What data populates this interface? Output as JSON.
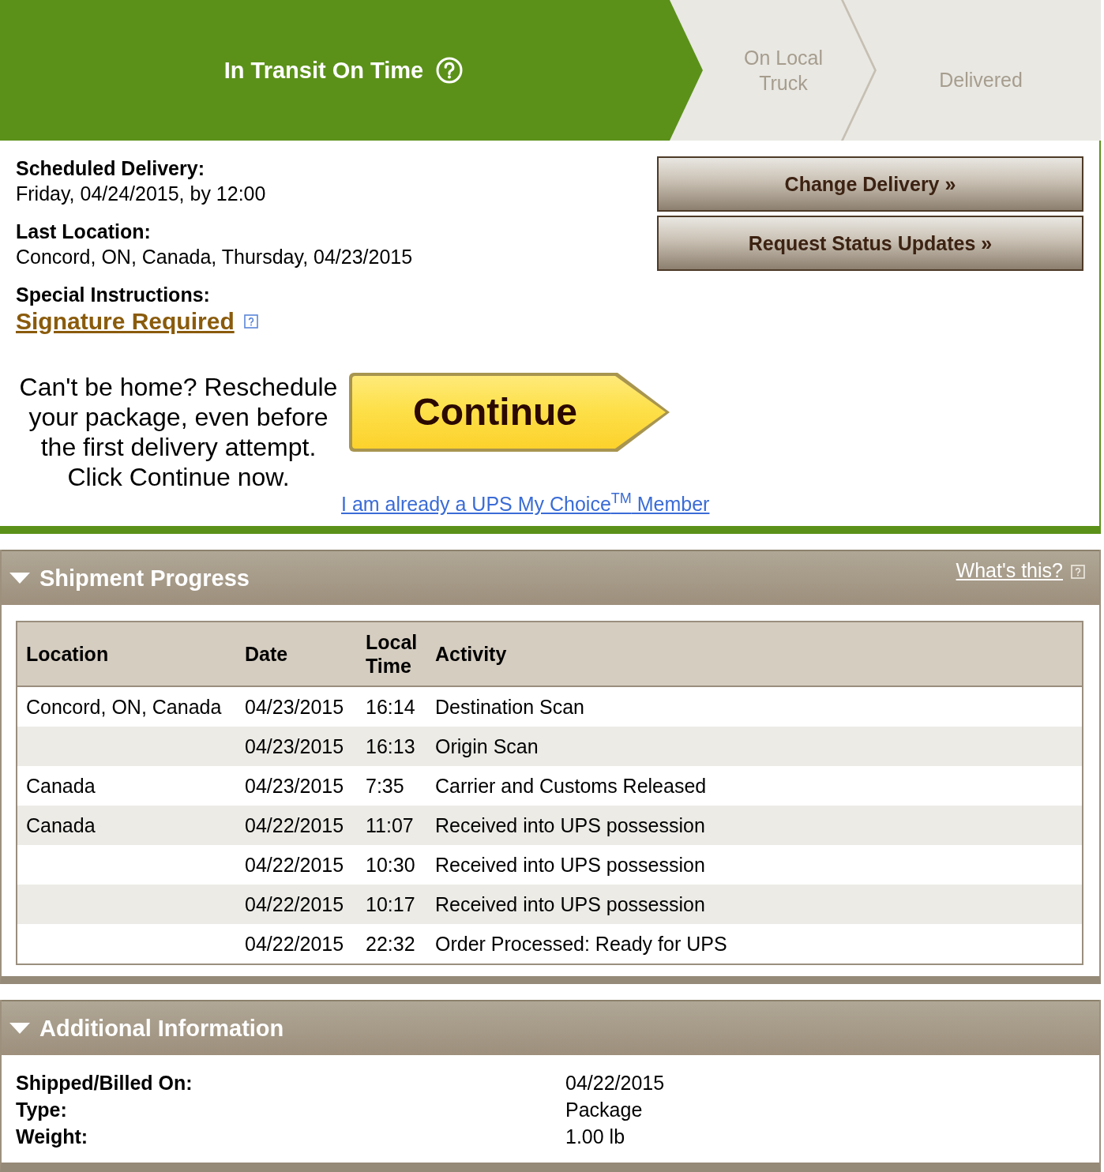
{
  "progress": {
    "steps": [
      {
        "label": "In Transit On Time",
        "active": true,
        "help": true
      },
      {
        "label": "On Local Truck",
        "active": false
      },
      {
        "label": "Delivered",
        "active": false
      }
    ]
  },
  "summary": {
    "fields": [
      {
        "label": "Scheduled Delivery:",
        "value": "Friday, 04/24/2015, by 12:00",
        "kind": "text"
      },
      {
        "label": "Last Location:",
        "value": "Concord, ON, Canada, Thursday, 04/23/2015",
        "kind": "text"
      },
      {
        "label": "Special Instructions:",
        "value": "Signature Required",
        "kind": "link",
        "help": true
      }
    ],
    "actions": [
      "Change Delivery »",
      "Request Status Updates »"
    ]
  },
  "reschedule": {
    "message": "Can't be home? Reschedule your package, even before the first delivery attempt. Click Continue now.",
    "button": "Continue",
    "member_link": "I am already a UPS My Choice$^{TM}$ Member"
  },
  "shipment_progress": {
    "title": "Shipment Progress",
    "expanded": true,
    "help_link": "What's this?",
    "columns": [
      "Location",
      "Date",
      "Local Time",
      "Activity"
    ],
    "rows": [
      {
        "location": "Concord, ON, Canada",
        "date": "04/23/2015",
        "time": "16:14",
        "activity": "Destination Scan"
      },
      {
        "date": "04/23/2015",
        "time": "16:13",
        "activity": "Origin Scan"
      },
      {
        "location": "Canada",
        "date": "04/23/2015",
        "time": "7:35",
        "activity": "Carrier and Customs Released"
      },
      {
        "location": "Canada",
        "date": "04/22/2015",
        "time": "11:07",
        "activity": "Received into UPS possession"
      },
      {
        "date": "04/22/2015",
        "time": "10:30",
        "activity": "Received into UPS possession"
      },
      {
        "date": "04/22/2015",
        "time": "10:17",
        "activity": "Received into UPS possession"
      },
      {
        "date": "04/22/2015",
        "time": "22:32",
        "activity": "Order Processed: Ready for UPS"
      }
    ]
  },
  "additional_information": {
    "title": "Additional Information",
    "expanded": true,
    "fields": [
      {
        "label": "Shipped/Billed On:",
        "value": "04/22/2015"
      },
      {
        "label": "Type:",
        "value": "Package"
      },
      {
        "label": "Weight:",
        "value": "1.00 lb"
      }
    ]
  }
}
